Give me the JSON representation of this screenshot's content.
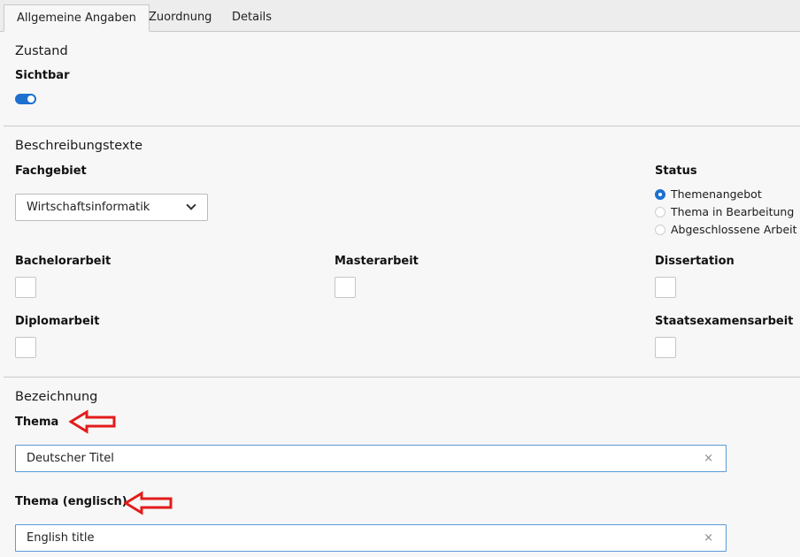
{
  "tabs": [
    {
      "label": "Allgemeine Angaben",
      "active": true
    },
    {
      "label": "Zuordnung",
      "active": false
    },
    {
      "label": "Details",
      "active": false
    }
  ],
  "zustand": {
    "title": "Zustand",
    "sichtbar_label": "Sichtbar",
    "sichtbar_on": true
  },
  "beschreibung": {
    "title": "Beschreibungstexte",
    "fachgebiet_label": "Fachgebiet",
    "fachgebiet_value": "Wirtschaftsinformatik",
    "status_label": "Status",
    "status_options": [
      {
        "label": "Themenangebot",
        "checked": true
      },
      {
        "label": "Thema in Bearbeitung",
        "checked": false
      },
      {
        "label": "Abgeschlossene Arbeit",
        "checked": false
      }
    ],
    "checkboxes": [
      {
        "label": "Bachelorarbeit",
        "checked": false
      },
      {
        "label": "Masterarbeit",
        "checked": false
      },
      {
        "label": "Dissertation",
        "checked": false
      },
      {
        "label": "Diplomarbeit",
        "checked": false
      },
      {
        "label": "Staatsexamensarbeit",
        "checked": false
      }
    ]
  },
  "bezeichnung": {
    "title": "Bezeichnung",
    "thema_label": "Thema",
    "thema_value": "Deutscher Titel",
    "thema_en_label": "Thema (englisch)",
    "thema_en_value": "English title",
    "clear_glyph": "×"
  },
  "colors": {
    "accent": "#1d70d0",
    "annotation_arrow": "#e41b1b",
    "field_border_focus": "#5b9bd5"
  },
  "icons": {
    "dropdown": "chevron-down-icon",
    "clear": "close-icon",
    "annotation": "arrow-left-icon"
  }
}
